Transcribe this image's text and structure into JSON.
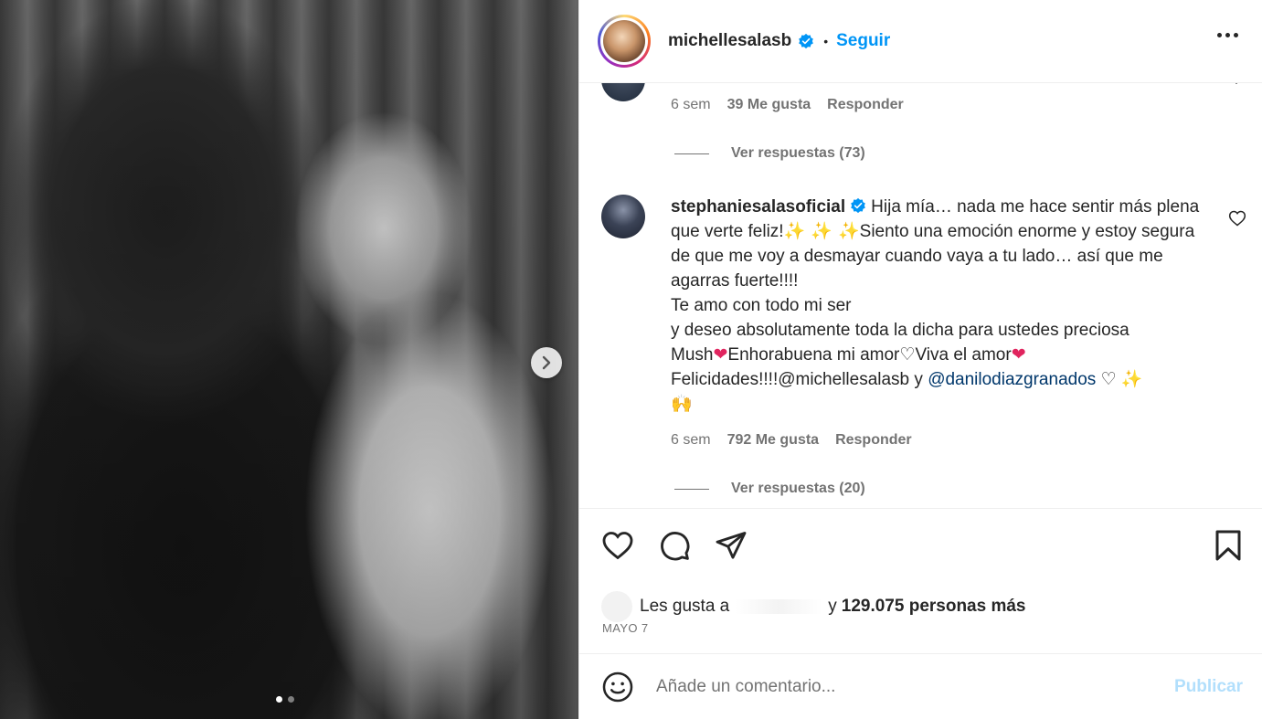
{
  "header": {
    "username": "michellesalasb",
    "separator": "•",
    "follow_label": "Seguir"
  },
  "comments": {
    "first": {
      "time": "6 sem",
      "likes": "39 Me gusta",
      "reply_label": "Responder",
      "view_replies": "Ver respuestas (73)"
    },
    "second": {
      "username": "stephaniesalasoficial",
      "text_part1": "Hija mía… nada me hace sentir más plena que verte feliz!",
      "sparkles1": "✨ ✨ ✨",
      "text_part2": "Siento una emoción enorme y estoy segura de que me voy a desmayar cuando vaya a tu lado… así que me agarras fuerte!!!!",
      "line2": "Te amo con todo mi ser",
      "line3": "y deseo absolutamente toda la dicha para ustedes preciosa",
      "mush": "Mush",
      "heart_red": "❤",
      "enhorabuena": "Enhorabuena mi amor",
      "heart_white": "♡",
      "viva": "Viva el amor",
      "felicidades": "Felicidades!!!!@michellesalasb y ",
      "mention": "@danilodiazgranados",
      "sparkle_single": "✨",
      "hands": "🙌",
      "time": "6 sem",
      "likes": "792 Me gusta",
      "reply_label": "Responder",
      "view_replies": "Ver respuestas (20)"
    }
  },
  "post": {
    "likes_prefix": "Les gusta a",
    "likes_joiner": "y",
    "likes_count": "129.075 personas más",
    "date": "MAYO 7"
  },
  "compose": {
    "placeholder": "Añade un comentario...",
    "publish_label": "Publicar"
  },
  "icons": {
    "like": "heart-icon",
    "comment": "comment-icon",
    "share": "share-icon",
    "save": "bookmark-icon",
    "emoji": "emoji-icon",
    "more": "more-options-icon",
    "next": "chevron-right-icon"
  },
  "colors": {
    "accent": "#0095f6",
    "publish_disabled": "#b2dffc",
    "text_secondary": "#737373"
  }
}
